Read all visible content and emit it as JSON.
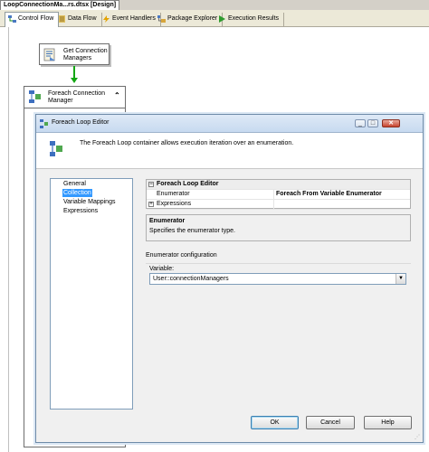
{
  "document_tab": {
    "title": "LoopConnectionMa...rs.dtsx [Design]"
  },
  "designer_tabs": [
    {
      "label": "Control Flow",
      "icon": "control-flow-icon",
      "active": true
    },
    {
      "label": "Data Flow",
      "icon": "data-flow-icon",
      "active": false
    },
    {
      "label": "Event Handlers",
      "icon": "event-handlers-icon",
      "active": false
    },
    {
      "label": "Package Explorer",
      "icon": "package-explorer-icon",
      "active": false
    },
    {
      "label": "Execution Results",
      "icon": "execution-results-icon",
      "active": false
    }
  ],
  "canvas": {
    "task": {
      "label": "Get Connection Managers",
      "icon": "script-task-icon"
    },
    "container": {
      "label": "Foreach Connection Manager",
      "icon": "foreach-loop-icon",
      "collapse_glyph": "⌃"
    }
  },
  "dialog": {
    "title": "Foreach Loop Editor",
    "banner_text": "The Foreach Loop container allows execution iteration over an enumeration.",
    "nav": [
      "General",
      "Collection",
      "Variable Mappings",
      "Expressions"
    ],
    "nav_selected": "Collection",
    "grid": {
      "category": "Foreach Loop Editor",
      "rows": [
        {
          "name": "Enumerator",
          "value": "Foreach From Variable Enumerator"
        },
        {
          "name": "Expressions",
          "value": ""
        }
      ]
    },
    "description": {
      "title": "Enumerator",
      "body": "Specifies the enumerator type."
    },
    "enum_config": {
      "group_label": "Enumerator configuration",
      "variable_label": "Variable:",
      "variable_value": "User::connectionManagers"
    },
    "buttons": {
      "ok": "OK",
      "cancel": "Cancel",
      "help": "Help"
    },
    "window_controls": {
      "minimize": "_",
      "maximize": "□",
      "close": "✕"
    }
  },
  "colors": {
    "accent": "#3399ff",
    "connector": "#13a713",
    "tab_strip": "#ece9d8"
  }
}
